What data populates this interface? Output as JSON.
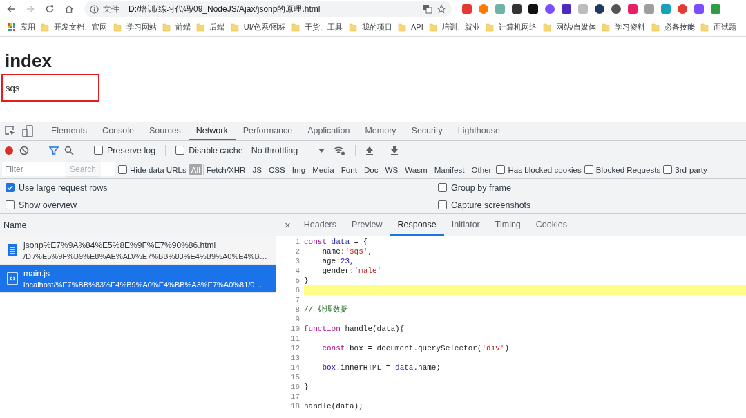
{
  "browser": {
    "nav": [
      {
        "kind": "back",
        "disabled": false
      },
      {
        "kind": "forward",
        "disabled": true
      },
      {
        "kind": "reload",
        "disabled": false
      },
      {
        "kind": "home",
        "disabled": false
      }
    ],
    "address": {
      "scheme": "文件",
      "url": "D:/培训/练习代码/09_NodeJS/Ajax/jsonp的原理.html"
    },
    "bookmarks": [
      {
        "kind": "apps",
        "label": "应用"
      },
      {
        "kind": "folder",
        "label": "开发文档、官网"
      },
      {
        "kind": "folder",
        "label": "学习网站"
      },
      {
        "kind": "folder",
        "label": "前端"
      },
      {
        "kind": "folder",
        "label": "后端"
      },
      {
        "kind": "folder",
        "label": "UI/色系/图标"
      },
      {
        "kind": "folder",
        "label": "干货、工具"
      },
      {
        "kind": "folder",
        "label": "我的项目"
      },
      {
        "kind": "folder",
        "label": "API"
      },
      {
        "kind": "folder",
        "label": "培训、就业"
      },
      {
        "kind": "folder",
        "label": "计算机网络"
      },
      {
        "kind": "folder",
        "label": "网站/自媒体"
      },
      {
        "kind": "folder",
        "label": "学习资料"
      },
      {
        "kind": "folder",
        "label": "必备技能"
      },
      {
        "kind": "folder",
        "label": "面试题"
      }
    ]
  },
  "page": {
    "heading": "index",
    "box_text": "sqs"
  },
  "devtools": {
    "tabs": [
      {
        "label": "Elements",
        "selected": false
      },
      {
        "label": "Console",
        "selected": false
      },
      {
        "label": "Sources",
        "selected": false
      },
      {
        "label": "Network",
        "selected": true
      },
      {
        "label": "Performance",
        "selected": false
      },
      {
        "label": "Application",
        "selected": false
      },
      {
        "label": "Memory",
        "selected": false
      },
      {
        "label": "Security",
        "selected": false
      },
      {
        "label": "Lighthouse",
        "selected": false
      }
    ],
    "toolbar": {
      "recording": true,
      "preserve_log": {
        "label": "Preserve log",
        "checked": false
      },
      "disable_cache": {
        "label": "Disable cache",
        "checked": false
      },
      "throttling": "No throttling"
    },
    "filter": {
      "placeholder": "Filter",
      "search_tooltip": "Search",
      "hide_data_urls": {
        "label": "Hide data URLs",
        "checked": false
      },
      "types": [
        {
          "label": "All",
          "selected": true
        },
        {
          "label": "Fetch/XHR",
          "selected": false
        },
        {
          "label": "JS",
          "selected": false
        },
        {
          "label": "CSS",
          "selected": false
        },
        {
          "label": "Img",
          "selected": false
        },
        {
          "label": "Media",
          "selected": false
        },
        {
          "label": "Font",
          "selected": false
        },
        {
          "label": "Doc",
          "selected": false
        },
        {
          "label": "WS",
          "selected": false
        },
        {
          "label": "Wasm",
          "selected": false
        },
        {
          "label": "Manifest",
          "selected": false
        },
        {
          "label": "Other",
          "selected": false
        }
      ],
      "checks": [
        {
          "label": "Has blocked cookies",
          "checked": false
        },
        {
          "label": "Blocked Requests",
          "checked": false
        },
        {
          "label": "3rd-party",
          "checked": false
        }
      ]
    },
    "options": [
      {
        "label": "Use large request rows",
        "checked": true
      },
      {
        "label": "Group by frame",
        "checked": false
      },
      {
        "label": "Show overview",
        "checked": false
      },
      {
        "label": "Capture screenshots",
        "checked": false
      }
    ],
    "requests": {
      "column": "Name",
      "rows": [
        {
          "kind": "document",
          "name": "jsonp%E7%9A%84%E5%8E%9F%E7%90%86.html",
          "path": "/D:/%E5%9F%B9%E8%AE%AD/%E7%BB%83%E4%B9%A0%E4%B…",
          "selected": false
        },
        {
          "kind": "script",
          "name": "main.js",
          "path": "localhost/%E7%BB%83%E4%B9%A0%E4%BB%A3%E7%A0%81/0…",
          "selected": true
        }
      ]
    },
    "detail": {
      "close": "×",
      "tabs": [
        {
          "label": "Headers",
          "selected": false
        },
        {
          "label": "Preview",
          "selected": false
        },
        {
          "label": "Response",
          "selected": true
        },
        {
          "label": "Initiator",
          "selected": false
        },
        {
          "label": "Timing",
          "selected": false
        },
        {
          "label": "Cookies",
          "selected": false
        }
      ],
      "code": [
        {
          "number": "1",
          "highlighted": false,
          "indented": false,
          "tokens": [
            {
              "kind": "keyword",
              "text": "const"
            },
            {
              "kind": "variable",
              "text": " data"
            },
            {
              "kind": "plain",
              "text": " = {"
            }
          ]
        },
        {
          "number": "2",
          "highlighted": false,
          "indented": true,
          "tokens": [
            {
              "kind": "plain",
              "text": "name:"
            },
            {
              "kind": "string",
              "text": "'sqs'"
            },
            {
              "kind": "plain",
              "text": ","
            }
          ]
        },
        {
          "number": "3",
          "highlighted": false,
          "indented": true,
          "tokens": [
            {
              "kind": "plain",
              "text": "age:"
            },
            {
              "kind": "number",
              "text": "23"
            },
            {
              "kind": "plain",
              "text": ","
            }
          ]
        },
        {
          "number": "4",
          "highlighted": false,
          "indented": true,
          "tokens": [
            {
              "kind": "plain",
              "text": "gender:"
            },
            {
              "kind": "string",
              "text": "'male'"
            }
          ]
        },
        {
          "number": "5",
          "highlighted": false,
          "indented": false,
          "tokens": [
            {
              "kind": "plain",
              "text": "}"
            }
          ]
        },
        {
          "number": "6",
          "highlighted": true
        },
        {
          "number": "7",
          "highlighted": false
        },
        {
          "number": "8",
          "highlighted": false,
          "indented": false,
          "tokens": [
            {
              "kind": "comment",
              "text": "// 处理数据"
            }
          ]
        },
        {
          "number": "9",
          "highlighted": false
        },
        {
          "number": "10",
          "highlighted": false,
          "indented": false,
          "tokens": [
            {
              "kind": "keyword",
              "text": "function"
            },
            {
              "kind": "plain",
              "text": " handle(data){"
            }
          ]
        },
        {
          "number": "11",
          "highlighted": false
        },
        {
          "number": "12",
          "highlighted": false,
          "indented": true,
          "tokens": [
            {
              "kind": "keyword",
              "text": "const"
            },
            {
              "kind": "plain",
              "text": " box = document.querySelector("
            },
            {
              "kind": "string",
              "text": "'div'"
            },
            {
              "kind": "plain",
              "text": ")"
            }
          ]
        },
        {
          "number": "13",
          "highlighted": false
        },
        {
          "number": "14",
          "highlighted": false,
          "indented": true,
          "tokens": [
            {
              "kind": "variable",
              "text": "box"
            },
            {
              "kind": "plain",
              "text": ".innerHTML = "
            },
            {
              "kind": "variable",
              "text": "data"
            },
            {
              "kind": "plain",
              "text": ".name;"
            }
          ]
        },
        {
          "number": "15",
          "highlighted": false
        },
        {
          "number": "16",
          "highlighted": false,
          "indented": false,
          "tokens": [
            {
              "kind": "plain",
              "text": "}"
            }
          ]
        },
        {
          "number": "17",
          "highlighted": false
        },
        {
          "number": "18",
          "highlighted": false,
          "indented": false,
          "tokens": [
            {
              "kind": "plain",
              "text": "handle(data);"
            }
          ]
        }
      ]
    }
  }
}
